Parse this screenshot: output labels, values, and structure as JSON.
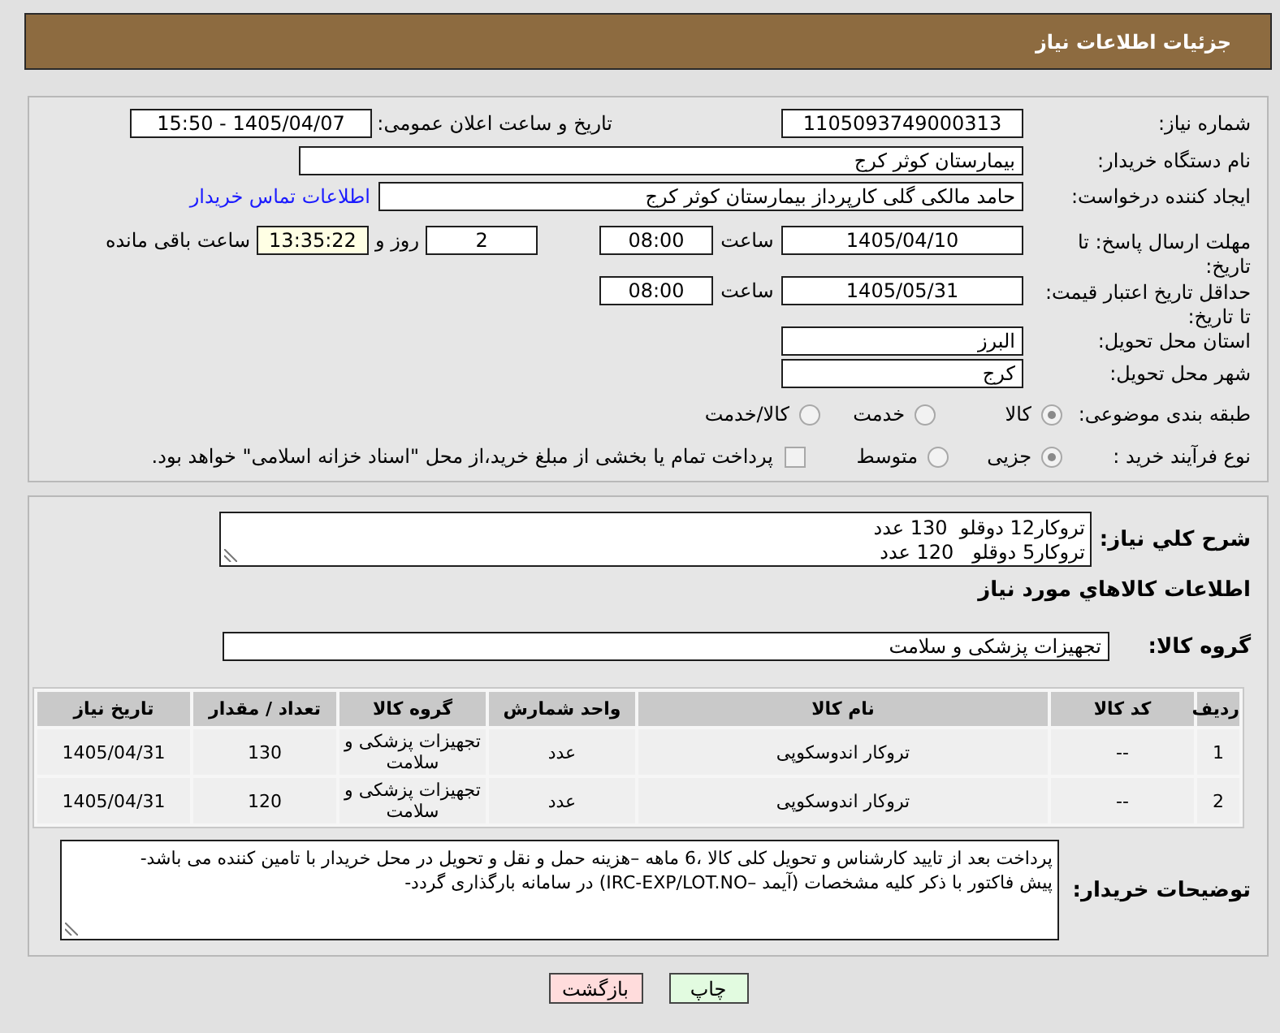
{
  "header": {
    "title": "جزئیات اطلاعات نیاز"
  },
  "need_number": {
    "label": "شماره نیاز:",
    "value": "1105093749000313"
  },
  "announce_datetime": {
    "label": "تاریخ و ساعت اعلان عمومی:",
    "value": "1405/04/07 - 15:50"
  },
  "buyer_org": {
    "label": "نام دستگاه خریدار:",
    "value": "بیمارستان کوثر کرج"
  },
  "requester": {
    "label": "ایجاد کننده درخواست:",
    "value": "حامد مالکی گلی کارپرداز بیمارستان کوثر کرج",
    "link": "اطلاعات تماس خریدار"
  },
  "reply_deadline": {
    "label": "مهلت ارسال پاسخ: تا تاریخ:",
    "date": "1405/04/10",
    "time_label": "ساعت",
    "time": "08:00",
    "days": "2",
    "days_label": "روز و",
    "remaining": "13:35:22",
    "remaining_label": "ساعت باقی مانده"
  },
  "price_validity": {
    "label": "حداقل تاریخ اعتبار قیمت: تا تاریخ:",
    "date": "1405/05/31",
    "time_label": "ساعت",
    "time": "08:00"
  },
  "province": {
    "label": "استان محل تحویل:",
    "value": "البرز"
  },
  "city": {
    "label": "شهر محل تحویل:",
    "value": "کرج"
  },
  "category": {
    "label": "طبقه بندی موضوعی:",
    "options": [
      {
        "label": "کالا",
        "selected": true
      },
      {
        "label": "خدمت",
        "selected": false
      },
      {
        "label": "کالا/خدمت",
        "selected": false
      }
    ]
  },
  "purchase_process": {
    "label": "نوع فرآیند خرید :",
    "options": [
      {
        "label": "جزیی",
        "selected": true
      },
      {
        "label": "متوسط",
        "selected": false
      }
    ],
    "treasury": {
      "label": "پرداخت تمام یا بخشی از مبلغ خرید،از محل \"اسناد خزانه اسلامی\" خواهد بود.",
      "checked": false
    }
  },
  "general_description": {
    "label": "شرح کلي نیاز:",
    "value": "تروکار12 دوقلو  130 عدد\nتروکار5 دوقلو   120 عدد"
  },
  "goods_section": {
    "title": "اطلاعات کالاهاي مورد نیاز"
  },
  "goods_group": {
    "label": "گروه کالا:",
    "value": "تجهیزات پزشکی و سلامت"
  },
  "table": {
    "columns": [
      "ردیف",
      "کد کالا",
      "نام کالا",
      "واحد شمارش",
      "گروه کالا",
      "تعداد / مقدار",
      "تاریخ نیاز"
    ],
    "rows": [
      [
        "1",
        "--",
        "تروکار اندوسکوپی",
        "عدد",
        "تجهیزات پزشکی و سلامت",
        "130",
        "1405/04/31"
      ],
      [
        "2",
        "--",
        "تروکار اندوسکوپی",
        "عدد",
        "تجهیزات پزشکی و سلامت",
        "120",
        "1405/04/31"
      ]
    ]
  },
  "buyer_notes": {
    "label": "توضیحات خریدار:",
    "value": "پرداخت بعد از تایید کارشناس و تحویل کلی کالا ،6 ماهه –هزینه حمل و نقل و تحویل در محل خریدار با تامین کننده می باشد-\nپیش فاکتور با ذکر کلیه مشخصات (آیمد –IRC-EXP/LOT.NO) در سامانه بارگذاری گردد-"
  },
  "buttons": [
    {
      "label": "چاپ",
      "kind": "print"
    },
    {
      "label": "بازگشت",
      "kind": "back"
    }
  ]
}
